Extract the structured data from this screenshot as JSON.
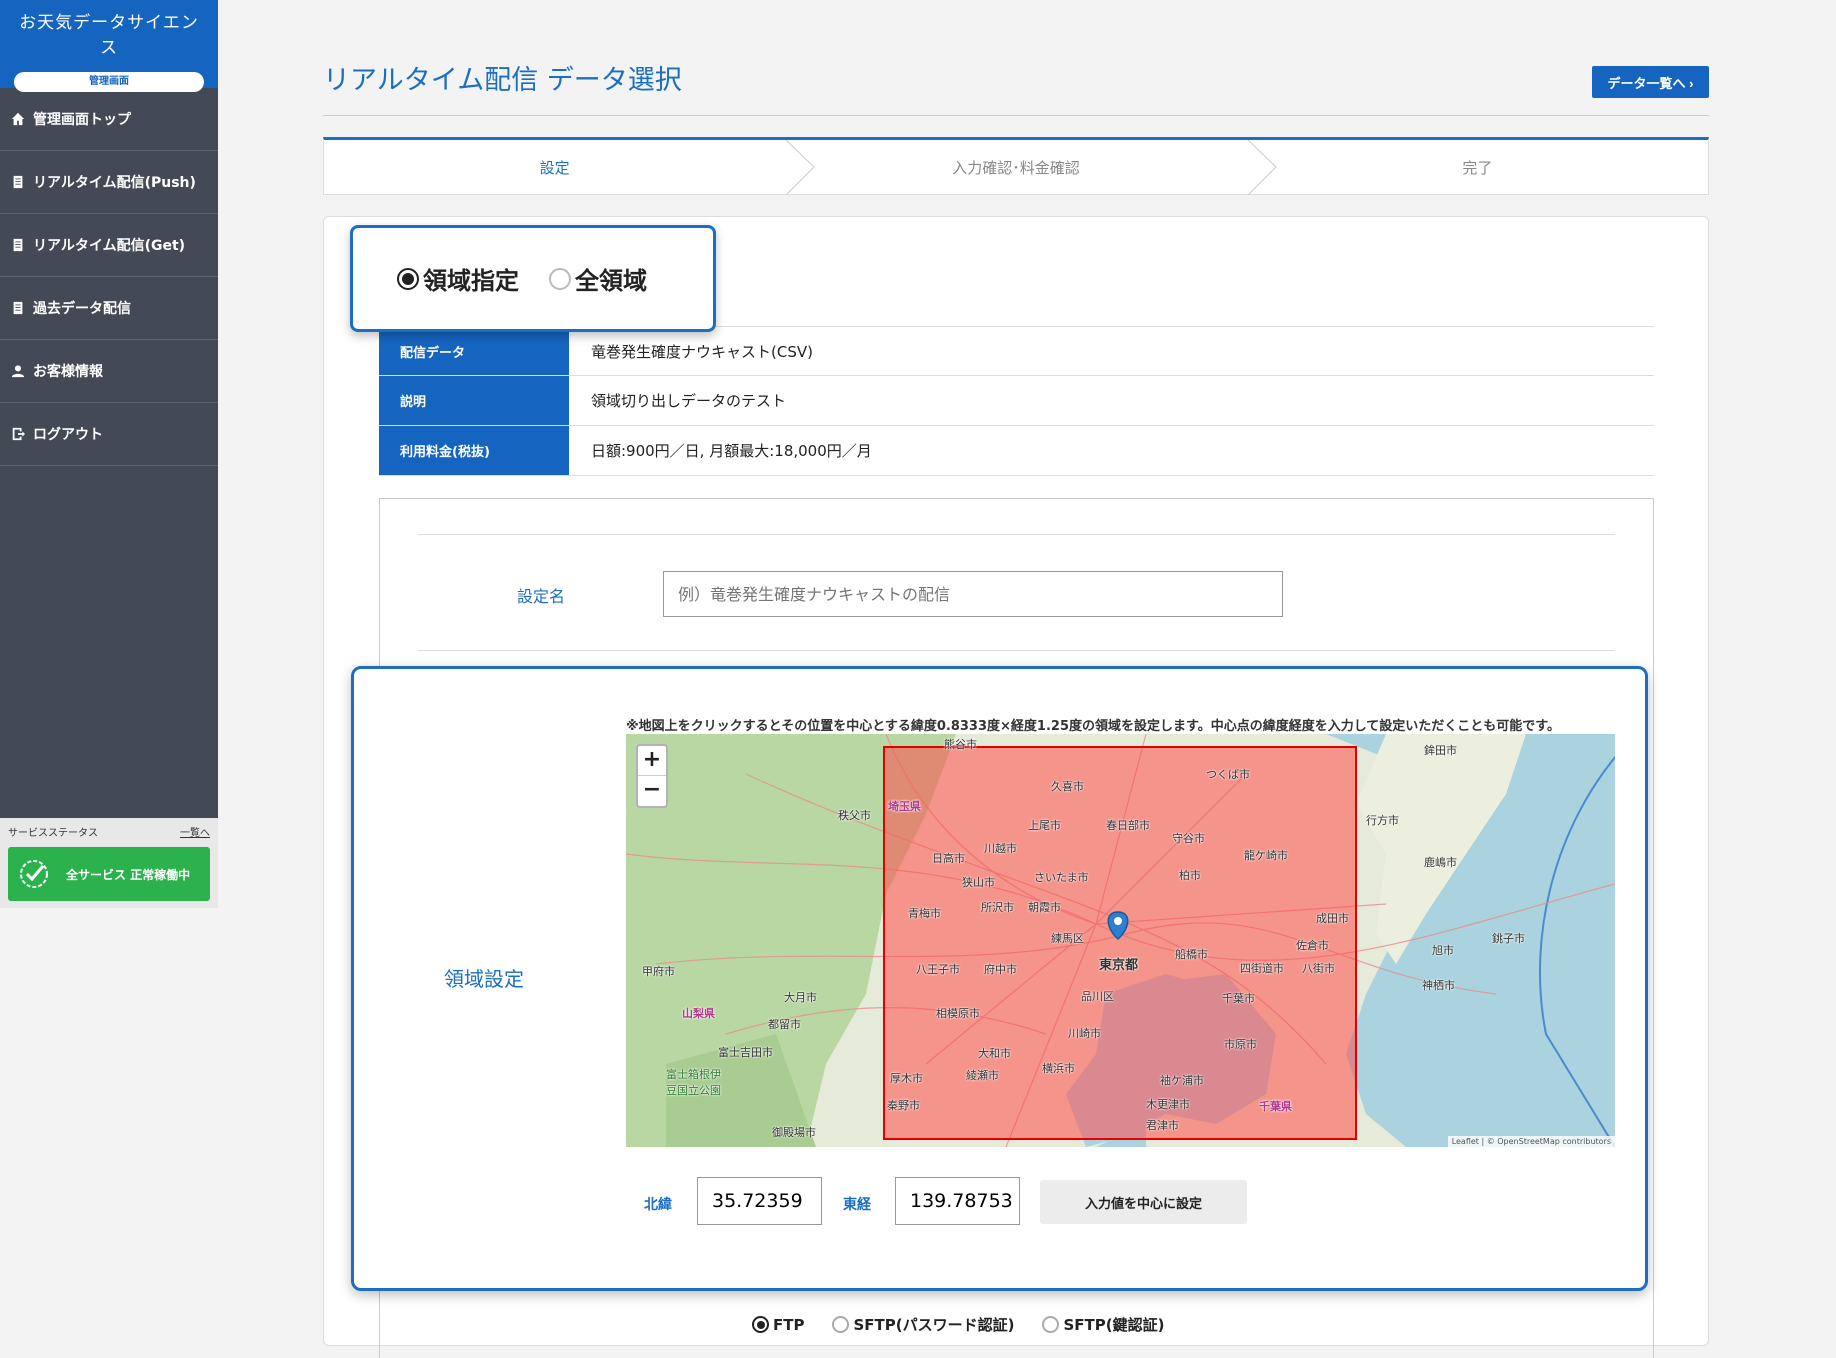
{
  "app": {
    "logo_text": "お天気データサイエンス",
    "logo_sub": "管理画面"
  },
  "sidebar": {
    "items": [
      {
        "label": "管理画面トップ",
        "icon": "home-icon"
      },
      {
        "label": "リアルタイム配信(Push)",
        "icon": "document-icon"
      },
      {
        "label": "リアルタイム配信(Get)",
        "icon": "document-icon"
      },
      {
        "label": "過去データ配信",
        "icon": "document-icon"
      },
      {
        "label": "お客様情報",
        "icon": "user-icon"
      },
      {
        "label": "ログアウト",
        "icon": "logout-icon"
      }
    ],
    "status": {
      "title": "サービスステータス",
      "link": "一覧へ",
      "message": "全サービス 正常稼働中"
    }
  },
  "header": {
    "title": "リアルタイム配信 データ選択",
    "data_list_button": "データ一覧へ"
  },
  "steps": [
    {
      "label": "設定",
      "active": true
    },
    {
      "label": "入力確認･料金確認",
      "active": false
    },
    {
      "label": "完了",
      "active": false
    }
  ],
  "region_mode": {
    "options": [
      "領域指定",
      "全領域"
    ],
    "selected": "領域指定"
  },
  "info": [
    {
      "key": "配信データ",
      "value": "竜巻発生確度ナウキャスト(CSV)"
    },
    {
      "key": "説明",
      "value": "領域切り出しデータのテスト"
    },
    {
      "key": "利用料金(税抜)",
      "value": "日額:900円／日, 月額最大:18,000円／月"
    }
  ],
  "form": {
    "setting_name_label": "設定名",
    "setting_name_placeholder": "例）竜巻発生確度ナウキャストの配信",
    "area_label": "領域設定",
    "map_note": "※地図上をクリックするとその位置を中心とする緯度0.8333度×経度1.25度の領域を設定します。中心点の緯度経度を入力して設定いただくことも可能です。",
    "map_attribution": "Leaflet | © OpenStreetMap contributors",
    "zoom_in": "+",
    "zoom_out": "−",
    "lat_label": "北緯",
    "lat_value": "35.72359",
    "lon_label": "東経",
    "lon_value": "139.78753",
    "center_button": "入力値を中心に設定"
  },
  "map_labels": {
    "tokyo": "東京都",
    "saitama": "さいたま市",
    "chiba": "千葉市",
    "kawasaki": "川崎市",
    "yokohama": "横浜市",
    "tsukuba": "つくば市",
    "kashiwa": "柏市",
    "funabashi": "船橋市",
    "hachioji": "八王子市",
    "fuchu": "府中市",
    "shinagawa": "品川区",
    "nerima": "練馬区",
    "sagamihara": "相模原市",
    "kawagoe": "川越市",
    "tokorozawa": "所沢市",
    "ichihara": "市原市",
    "kisarazu": "木更津市",
    "narita": "成田市",
    "sakura": "佐倉市",
    "choshi": "銚子市",
    "kofu": "甲府市",
    "otsuki": "大月市",
    "tsuru": "都留市",
    "chichibu": "秩父市",
    "gotemba": "御殿場市",
    "hadano": "秦野市",
    "kumagaya": "熊谷市",
    "kamisu": "神栖市",
    "asahi": "旭市",
    "kashima": "鹿嶋市",
    "hokota": "鉾田市",
    "namegata": "行方市",
    "moriya": "守谷市",
    "ome": "青梅市",
    "fujiyoshida": "富士吉田市",
    "saitama_pref": "埼玉県",
    "yamanashi_pref": "山梨県",
    "chiba_pref": "千葉県",
    "hakone": "富士箱根伊豆国立公園",
    "ryugasaki": "龍ケ崎市",
    "kasukabe": "春日部市",
    "ageo": "上尾市",
    "kuki": "久喜市",
    "hidaka": "日高市",
    "sayama": "狭山市",
    "asaka": "朝霞市",
    "yotsukaido": "四街道市",
    "yachimata": "八街市",
    "sodegaura": "袖ケ浦市",
    "kimitsu": "君津市",
    "yamato": "大和市",
    "ayase": "綾瀬市",
    "atsugi": "厚木市"
  },
  "protocols": {
    "options": [
      "FTP",
      "SFTP(パスワード認証)",
      "SFTP(鍵認証)"
    ],
    "selected": "FTP"
  },
  "colors": {
    "primary": "#1565c0",
    "accent_text": "#1b6ec2",
    "sidebar_bg": "#434a55",
    "status_ok": "#2bb24c",
    "region_fill": "#ff4d4d"
  }
}
